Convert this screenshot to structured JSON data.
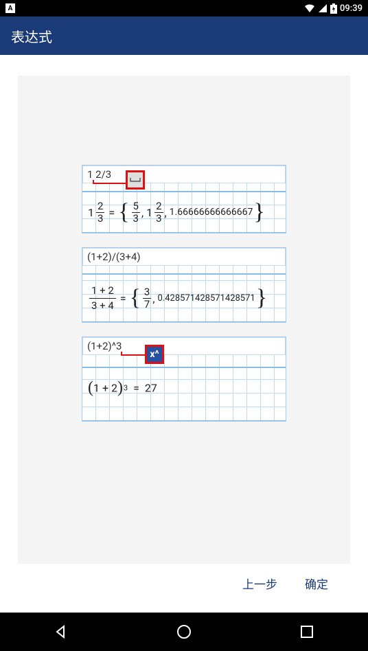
{
  "status": {
    "time": "09:39"
  },
  "appbar": {
    "title": "表达式"
  },
  "examples": [
    {
      "input": "1 2/3",
      "icon_name": "space-icon",
      "result": {
        "mixed_whole": "1",
        "mixed_num": "2",
        "mixed_den": "3",
        "frac_num": "5",
        "frac_den": "3",
        "second_mixed_whole": "1",
        "second_mixed_num": "2",
        "second_mixed_den": "3",
        "decimal": "1.66666666666667"
      }
    },
    {
      "input": "(1+2)/(3+4)",
      "result": {
        "frac_top": "1 + 2",
        "frac_bot": "3 + 4",
        "simple_num": "3",
        "simple_den": "7",
        "decimal": "0.428571428571428571"
      }
    },
    {
      "input": "(1+2)^3",
      "icon_name": "power-icon",
      "icon_label": "x^",
      "result": {
        "base": "1 + 2",
        "exp": "3",
        "value": "27"
      }
    }
  ],
  "buttons": {
    "back": "上一步",
    "ok": "确定"
  }
}
